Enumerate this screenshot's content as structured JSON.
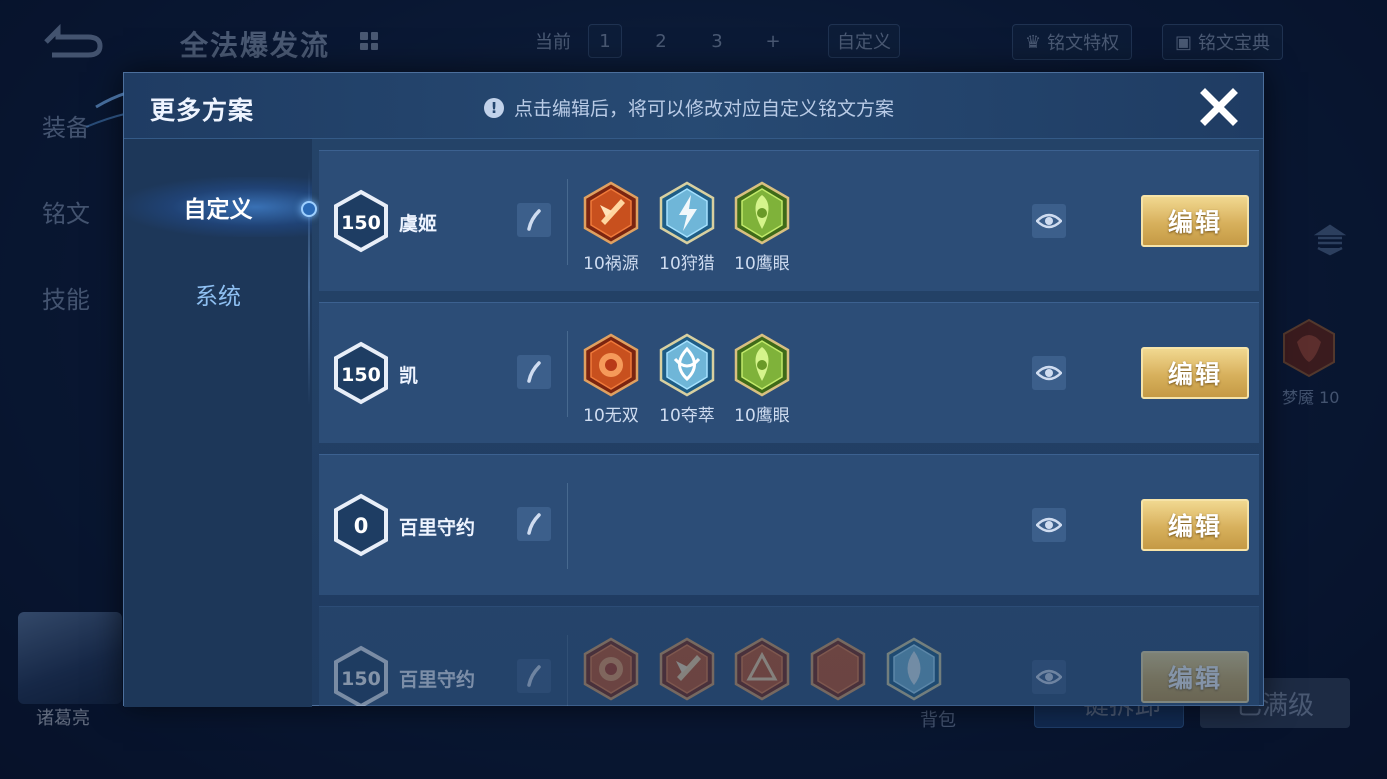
{
  "background": {
    "page_title": "全法爆发流",
    "tabs": {
      "current_label": "当前",
      "slots": [
        "1",
        "2",
        "3"
      ],
      "add_label": "+",
      "custom_label": "自定义"
    },
    "rune_privilege": "铭文特权",
    "rune_codex": "铭文宝典",
    "side_nav": [
      "装备",
      "铭文",
      "技能"
    ],
    "hero_name": "诸葛亮",
    "bag_label": "背包",
    "one_click_label": "一键拆卸",
    "max_level_label": "已满级",
    "side_rune_label": "梦魇 10"
  },
  "modal": {
    "title": "更多方案",
    "note": "点击编辑后，将可以修改对应自定义铭文方案",
    "sidebar": {
      "tabs": [
        {
          "label": "自定义",
          "active": true
        },
        {
          "label": "系统",
          "active": false
        }
      ]
    },
    "edit_label": "编辑",
    "schemes": [
      {
        "level": "150",
        "name": "虞姬",
        "runes": [
          {
            "label": "10祸源",
            "color": "red",
            "glyph": "blade"
          },
          {
            "label": "10狩猎",
            "color": "blue",
            "glyph": "bolt"
          },
          {
            "label": "10鹰眼",
            "color": "green",
            "glyph": "leaf"
          }
        ]
      },
      {
        "level": "150",
        "name": "凯",
        "runes": [
          {
            "label": "10无双",
            "color": "red",
            "glyph": "rose"
          },
          {
            "label": "10夺萃",
            "color": "blue",
            "glyph": "knot"
          },
          {
            "label": "10鹰眼",
            "color": "green",
            "glyph": "leaf"
          }
        ]
      },
      {
        "level": "0",
        "name": "百里守约",
        "runes": []
      },
      {
        "level": "150",
        "name": "百里守约",
        "runes": [
          {
            "label": "",
            "color": "red",
            "glyph": "rose"
          },
          {
            "label": "",
            "color": "red",
            "glyph": "blade"
          },
          {
            "label": "",
            "color": "red",
            "glyph": "tri"
          },
          {
            "label": "",
            "color": "red",
            "glyph": "moon"
          },
          {
            "label": "",
            "color": "blue",
            "glyph": "drop"
          }
        ]
      }
    ]
  },
  "colors": {
    "accent_gold": "#d7b05c",
    "modal_bg": "#254469",
    "row_bg": "#2c4d77",
    "rune_red": "#c8501e",
    "rune_blue": "#6fb6d8",
    "rune_green": "#7fb23a"
  }
}
